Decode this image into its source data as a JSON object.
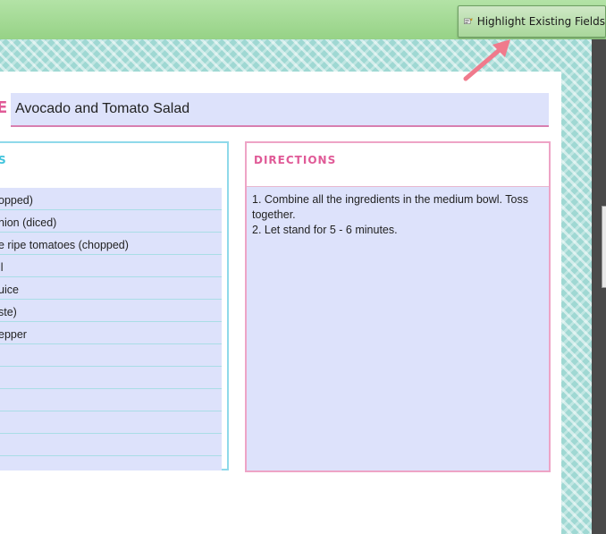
{
  "toolbar": {
    "highlight_label": "Highlight Existing Fields"
  },
  "recipe": {
    "title": "Avocado and Tomato Salad",
    "title_partial": "E"
  },
  "ingredients": {
    "header_partial": "S",
    "items": [
      "opped)",
      "nion (diced)",
      "e ripe tomatoes (chopped)",
      "il",
      "uice",
      "ste)",
      "epper",
      "",
      "",
      "",
      "",
      ""
    ]
  },
  "directions": {
    "header": "DIRECTIONS",
    "lines": [
      "1. Combine all the ingredients in the medium bowl. Toss together.",
      "2. Let stand for 5 - 6 minutes."
    ]
  },
  "colors": {
    "toolbar_green": "#96d286",
    "field_bg": "#dde2fb",
    "ingredients_accent": "#3fc3dc",
    "directions_accent": "#e05a97",
    "pattern_teal": "#9fd8d3",
    "arrow": "#f07a8c"
  },
  "icons": [
    "highlight-fields-icon",
    "arrow-pointer-icon"
  ]
}
